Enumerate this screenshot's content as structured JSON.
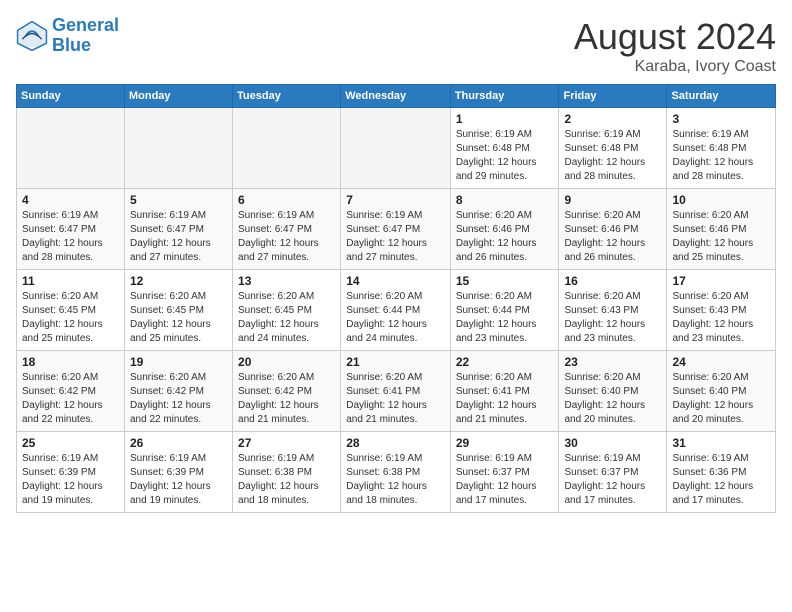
{
  "header": {
    "logo_line1": "General",
    "logo_line2": "Blue",
    "main_title": "August 2024",
    "subtitle": "Karaba, Ivory Coast"
  },
  "days_of_week": [
    "Sunday",
    "Monday",
    "Tuesday",
    "Wednesday",
    "Thursday",
    "Friday",
    "Saturday"
  ],
  "weeks": [
    [
      {
        "day": "",
        "info": ""
      },
      {
        "day": "",
        "info": ""
      },
      {
        "day": "",
        "info": ""
      },
      {
        "day": "",
        "info": ""
      },
      {
        "day": "1",
        "info": "Sunrise: 6:19 AM\nSunset: 6:48 PM\nDaylight: 12 hours and 29 minutes."
      },
      {
        "day": "2",
        "info": "Sunrise: 6:19 AM\nSunset: 6:48 PM\nDaylight: 12 hours and 28 minutes."
      },
      {
        "day": "3",
        "info": "Sunrise: 6:19 AM\nSunset: 6:48 PM\nDaylight: 12 hours and 28 minutes."
      }
    ],
    [
      {
        "day": "4",
        "info": "Sunrise: 6:19 AM\nSunset: 6:47 PM\nDaylight: 12 hours and 28 minutes."
      },
      {
        "day": "5",
        "info": "Sunrise: 6:19 AM\nSunset: 6:47 PM\nDaylight: 12 hours and 27 minutes."
      },
      {
        "day": "6",
        "info": "Sunrise: 6:19 AM\nSunset: 6:47 PM\nDaylight: 12 hours and 27 minutes."
      },
      {
        "day": "7",
        "info": "Sunrise: 6:19 AM\nSunset: 6:47 PM\nDaylight: 12 hours and 27 minutes."
      },
      {
        "day": "8",
        "info": "Sunrise: 6:20 AM\nSunset: 6:46 PM\nDaylight: 12 hours and 26 minutes."
      },
      {
        "day": "9",
        "info": "Sunrise: 6:20 AM\nSunset: 6:46 PM\nDaylight: 12 hours and 26 minutes."
      },
      {
        "day": "10",
        "info": "Sunrise: 6:20 AM\nSunset: 6:46 PM\nDaylight: 12 hours and 25 minutes."
      }
    ],
    [
      {
        "day": "11",
        "info": "Sunrise: 6:20 AM\nSunset: 6:45 PM\nDaylight: 12 hours and 25 minutes."
      },
      {
        "day": "12",
        "info": "Sunrise: 6:20 AM\nSunset: 6:45 PM\nDaylight: 12 hours and 25 minutes."
      },
      {
        "day": "13",
        "info": "Sunrise: 6:20 AM\nSunset: 6:45 PM\nDaylight: 12 hours and 24 minutes."
      },
      {
        "day": "14",
        "info": "Sunrise: 6:20 AM\nSunset: 6:44 PM\nDaylight: 12 hours and 24 minutes."
      },
      {
        "day": "15",
        "info": "Sunrise: 6:20 AM\nSunset: 6:44 PM\nDaylight: 12 hours and 23 minutes."
      },
      {
        "day": "16",
        "info": "Sunrise: 6:20 AM\nSunset: 6:43 PM\nDaylight: 12 hours and 23 minutes."
      },
      {
        "day": "17",
        "info": "Sunrise: 6:20 AM\nSunset: 6:43 PM\nDaylight: 12 hours and 23 minutes."
      }
    ],
    [
      {
        "day": "18",
        "info": "Sunrise: 6:20 AM\nSunset: 6:42 PM\nDaylight: 12 hours and 22 minutes."
      },
      {
        "day": "19",
        "info": "Sunrise: 6:20 AM\nSunset: 6:42 PM\nDaylight: 12 hours and 22 minutes."
      },
      {
        "day": "20",
        "info": "Sunrise: 6:20 AM\nSunset: 6:42 PM\nDaylight: 12 hours and 21 minutes."
      },
      {
        "day": "21",
        "info": "Sunrise: 6:20 AM\nSunset: 6:41 PM\nDaylight: 12 hours and 21 minutes."
      },
      {
        "day": "22",
        "info": "Sunrise: 6:20 AM\nSunset: 6:41 PM\nDaylight: 12 hours and 21 minutes."
      },
      {
        "day": "23",
        "info": "Sunrise: 6:20 AM\nSunset: 6:40 PM\nDaylight: 12 hours and 20 minutes."
      },
      {
        "day": "24",
        "info": "Sunrise: 6:20 AM\nSunset: 6:40 PM\nDaylight: 12 hours and 20 minutes."
      }
    ],
    [
      {
        "day": "25",
        "info": "Sunrise: 6:19 AM\nSunset: 6:39 PM\nDaylight: 12 hours and 19 minutes."
      },
      {
        "day": "26",
        "info": "Sunrise: 6:19 AM\nSunset: 6:39 PM\nDaylight: 12 hours and 19 minutes."
      },
      {
        "day": "27",
        "info": "Sunrise: 6:19 AM\nSunset: 6:38 PM\nDaylight: 12 hours and 18 minutes."
      },
      {
        "day": "28",
        "info": "Sunrise: 6:19 AM\nSunset: 6:38 PM\nDaylight: 12 hours and 18 minutes."
      },
      {
        "day": "29",
        "info": "Sunrise: 6:19 AM\nSunset: 6:37 PM\nDaylight: 12 hours and 17 minutes."
      },
      {
        "day": "30",
        "info": "Sunrise: 6:19 AM\nSunset: 6:37 PM\nDaylight: 12 hours and 17 minutes."
      },
      {
        "day": "31",
        "info": "Sunrise: 6:19 AM\nSunset: 6:36 PM\nDaylight: 12 hours and 17 minutes."
      }
    ]
  ]
}
